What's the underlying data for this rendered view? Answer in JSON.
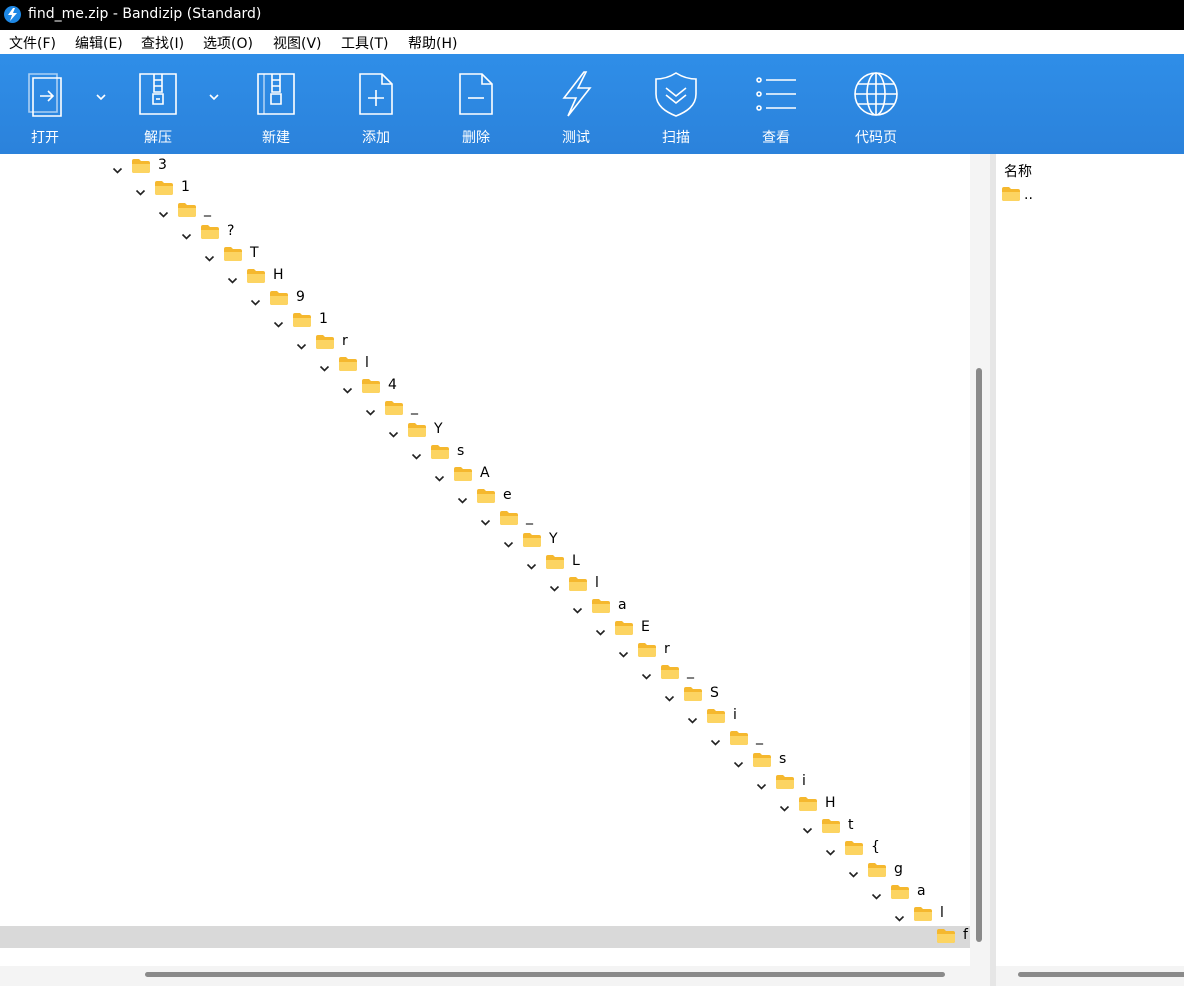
{
  "window": {
    "title": "find_me.zip - Bandizip (Standard)"
  },
  "menu": [
    "文件(F)",
    "编辑(E)",
    "查找(I)",
    "选项(O)",
    "视图(V)",
    "工具(T)",
    "帮助(H)"
  ],
  "toolbar": {
    "buttons": [
      {
        "label": "打开",
        "icon": "open-archive-icon",
        "dropdown": true
      },
      {
        "label": "解压",
        "icon": "extract-icon",
        "dropdown": true
      },
      {
        "label": "新建",
        "icon": "new-archive-icon",
        "dropdown": false
      },
      {
        "label": "添加",
        "icon": "add-file-icon",
        "dropdown": false
      },
      {
        "label": "删除",
        "icon": "delete-file-icon",
        "dropdown": false
      },
      {
        "label": "测试",
        "icon": "test-lightning-icon",
        "dropdown": false
      },
      {
        "label": "扫描",
        "icon": "scan-shield-icon",
        "dropdown": false
      },
      {
        "label": "查看",
        "icon": "view-list-icon",
        "dropdown": false
      },
      {
        "label": "代码页",
        "icon": "codepage-globe-icon",
        "dropdown": false
      }
    ]
  },
  "tree": {
    "nodes": [
      "3",
      "1",
      "_",
      "?",
      "T",
      "H",
      "9",
      "1",
      "r",
      "l",
      "4",
      "_",
      "Y",
      "s",
      "A",
      "e",
      "_",
      "Y",
      "L",
      "l",
      "a",
      "E",
      "r",
      "_",
      "S",
      "i",
      "_",
      "s",
      "i",
      "H",
      "t",
      "{",
      "g",
      "a",
      "l",
      "f"
    ],
    "selected_index": 35
  },
  "file_list": {
    "header": "名称",
    "rows": [
      ".."
    ]
  },
  "colors": {
    "toolbar": "#2b85df",
    "folder": "#f8c84a",
    "selection": "#d9d9d9"
  }
}
